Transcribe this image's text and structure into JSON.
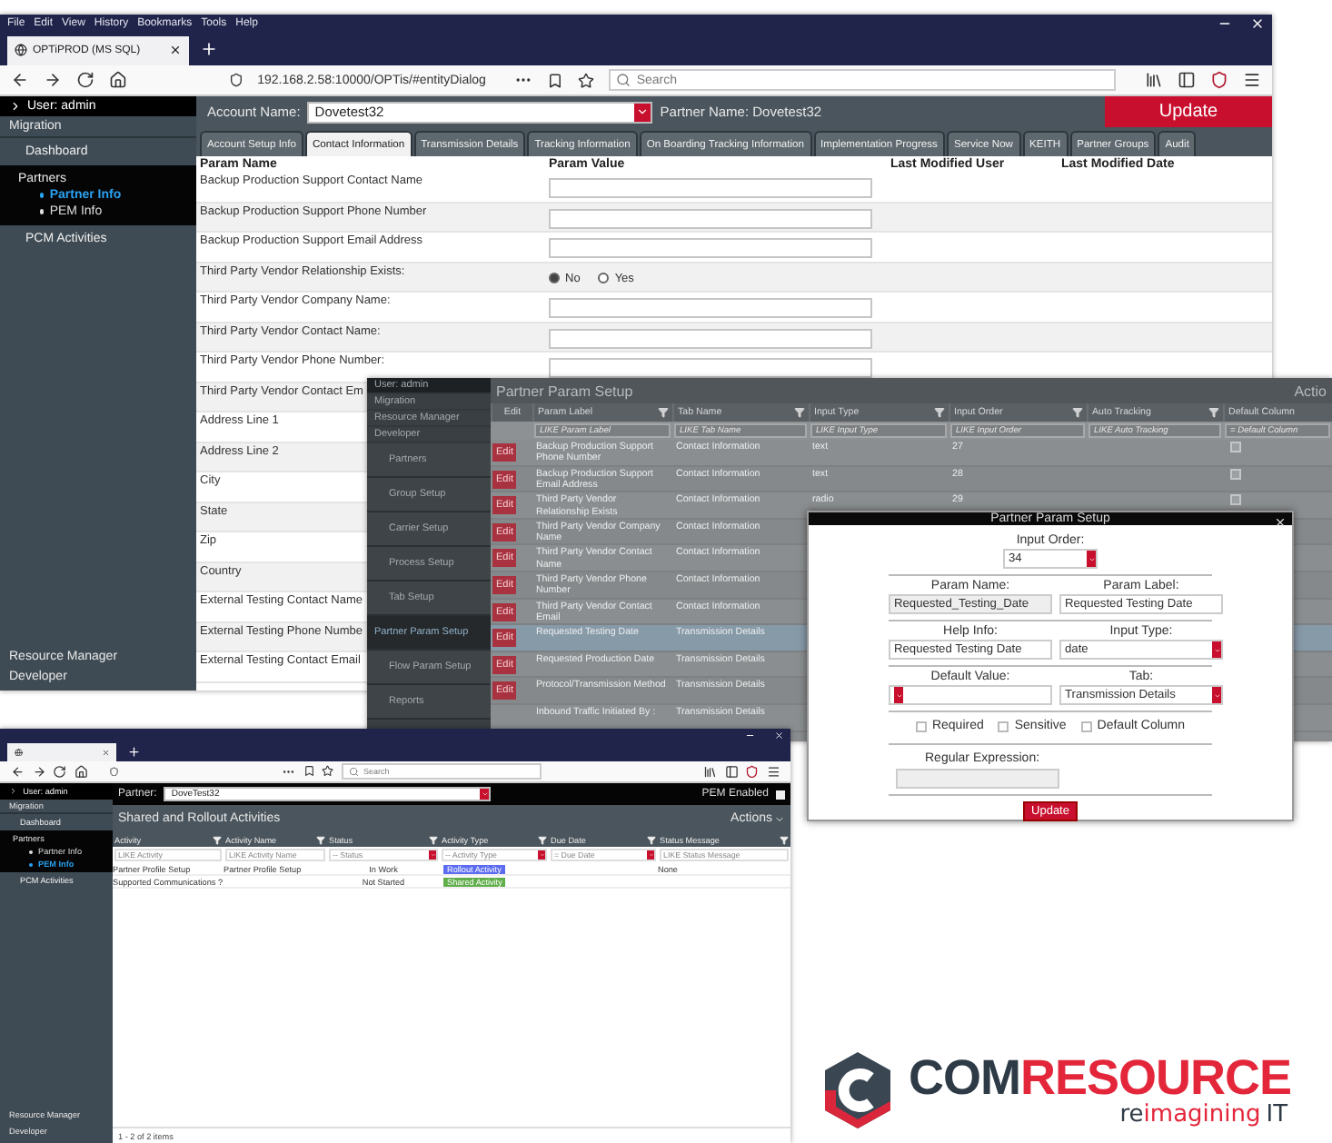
{
  "screenshot_a": {
    "browser": {
      "menu": [
        "File",
        "Edit",
        "View",
        "History",
        "Bookmarks",
        "Tools",
        "Help"
      ],
      "tab_title": "OPTiPROD (MS SQL)",
      "url": "192.168.2.58:10000/OPTis/#entityDialog",
      "search_placeholder": "Search"
    },
    "sidebar": {
      "user": "User: admin",
      "items": [
        {
          "label": "Migration",
          "kind": "header"
        },
        {
          "label": "Dashboard",
          "kind": "item"
        },
        {
          "label": "Partners",
          "kind": "group",
          "expanded": true,
          "children": [
            {
              "label": "Partner Info",
              "selected": true
            },
            {
              "label": "PEM Info",
              "selected": false
            }
          ]
        },
        {
          "label": "PCM Activities",
          "kind": "item"
        }
      ],
      "footer": [
        "Resource Manager",
        "Developer"
      ]
    },
    "account_label": "Account Name:",
    "account_value": "Dovetest32",
    "partner_name": "Partner Name: Dovetest32",
    "update_button": "Update",
    "tabs": [
      {
        "label": "Account Setup Info",
        "selected": false
      },
      {
        "label": "Contact Information",
        "selected": true
      },
      {
        "label": "Transmission Details",
        "selected": false
      },
      {
        "label": "Tracking Information",
        "selected": false
      },
      {
        "label": "On Boarding Tracking Information",
        "selected": false
      },
      {
        "label": "Implementation Progress",
        "selected": false
      },
      {
        "label": "Service Now",
        "selected": false
      },
      {
        "label": "KEITH",
        "selected": false
      },
      {
        "label": "Partner Groups",
        "selected": false
      },
      {
        "label": "Audit",
        "selected": false
      }
    ],
    "columns": [
      "Param Name",
      "Param Value",
      "Last Modified User",
      "Last Modified Date"
    ],
    "rows": [
      {
        "name": "Backup Production Support Contact Name",
        "kind": "text"
      },
      {
        "name": "Backup Production Support Phone Number",
        "kind": "text"
      },
      {
        "name": "Backup Production Support Email Address",
        "kind": "text"
      },
      {
        "name": "Third Party Vendor Relationship Exists:",
        "kind": "radio",
        "options": [
          {
            "label": "No",
            "selected": true
          },
          {
            "label": "Yes",
            "selected": false
          }
        ]
      },
      {
        "name": "Third Party Vendor Company Name:",
        "kind": "text"
      },
      {
        "name": "Third Party Vendor Contact Name:",
        "kind": "text"
      },
      {
        "name": "Third Party Vendor Phone Number:",
        "kind": "text"
      },
      {
        "name": "Third Party Vendor Contact Em",
        "kind": "label"
      },
      {
        "name": "Address Line 1",
        "kind": "label"
      },
      {
        "name": "Address Line 2",
        "kind": "label"
      },
      {
        "name": "City",
        "kind": "label"
      },
      {
        "name": "State",
        "kind": "label"
      },
      {
        "name": "Zip",
        "kind": "label"
      },
      {
        "name": "Country",
        "kind": "label"
      },
      {
        "name": "External Testing Contact Name",
        "kind": "label"
      },
      {
        "name": "External Testing Phone Numbe",
        "kind": "label"
      },
      {
        "name": "External Testing Contact Email",
        "kind": "label"
      }
    ]
  },
  "screenshot_b": {
    "sidebar": {
      "top": [
        "User: admin",
        "Migration",
        "Resource Manager",
        "Developer"
      ],
      "items": [
        {
          "label": "Partners",
          "selected": false
        },
        {
          "label": "Group Setup",
          "selected": false
        },
        {
          "label": "Carrier Setup",
          "selected": false
        },
        {
          "label": "Process Setup",
          "selected": false
        },
        {
          "label": "Tab Setup",
          "selected": false
        },
        {
          "label": "Partner Param Setup",
          "selected": true
        },
        {
          "label": "Flow Param Setup",
          "selected": false
        },
        {
          "label": "Reports",
          "selected": false
        }
      ]
    },
    "title": "Partner Param Setup",
    "actions": "Actio",
    "columns": [
      "Edit",
      "Param Label",
      "Tab Name",
      "Input Type",
      "Input Order",
      "Auto Tracking",
      "Default Column"
    ],
    "filters": [
      "LIKE Param Label",
      "LIKE Tab Name",
      "LIKE Input Type",
      "LIKE Input Order",
      "LIKE Auto Tracking",
      "= Default Column"
    ],
    "rows": [
      {
        "edit": "Edit",
        "label": "Backup Production Support Phone Number",
        "tab": "Contact Information",
        "input_type": "text",
        "input_order": "27",
        "default_column": false,
        "selected": false
      },
      {
        "edit": "Edit",
        "label": "Backup Production Support Email Address",
        "tab": "Contact Information",
        "input_type": "text",
        "input_order": "28",
        "default_column": false,
        "selected": false
      },
      {
        "edit": "Edit",
        "label": "Third Party Vendor Relationship Exists",
        "tab": "Contact Information",
        "input_type": "radio",
        "input_order": "29",
        "default_column": false,
        "selected": false
      },
      {
        "edit": "Edit",
        "label": "Third Party Vendor Company Name",
        "tab": "Contact Information",
        "selected": false
      },
      {
        "edit": "Edit",
        "label": "Third Party Vendor Contact Name",
        "tab": "Contact Information",
        "selected": false
      },
      {
        "edit": "Edit",
        "label": "Third Party Vendor Phone Number",
        "tab": "Contact Information",
        "selected": false
      },
      {
        "edit": "Edit",
        "label": "Third Party Vendor Contact Email",
        "tab": "Contact Information",
        "selected": false
      },
      {
        "edit": "Edit",
        "label": "Requested Testing Date",
        "tab": "Transmission Details",
        "selected": true
      },
      {
        "edit": "Edit",
        "label": "Requested Production Date",
        "tab": "Transmission Details",
        "selected": false
      },
      {
        "edit": "Edit",
        "label": "Protocol/Transmission Method",
        "tab": "Transmission Details",
        "selected": false
      },
      {
        "label": "Inbound Traffic Initiated By :",
        "tab": "Transmission Details",
        "selected": false
      }
    ]
  },
  "dialog": {
    "title": "Partner Param Setup",
    "rows": [
      [
        {
          "label": "Input Order:",
          "value": "34",
          "kind": "select"
        }
      ],
      [
        {
          "label": "Param Name:",
          "value": "Requested_Testing_Date",
          "kind": "readonly"
        },
        {
          "label": "Param Label:",
          "value": "Requested Testing Date",
          "kind": "text"
        }
      ],
      [
        {
          "label": "Help Info:",
          "value": "Requested Testing Date",
          "kind": "text"
        },
        {
          "label": "Input Type:",
          "value": "date",
          "kind": "select"
        }
      ],
      [
        {
          "label": "Default Value:",
          "kind": "select"
        },
        {
          "label": "Tab:",
          "value": "Transmission Details",
          "kind": "select"
        }
      ]
    ],
    "checkboxes": [
      {
        "label": "Required",
        "checked": false
      },
      {
        "label": "Sensitive",
        "checked": false
      },
      {
        "label": "Default Column",
        "checked": false
      }
    ],
    "regex_label": "Regular Expression:",
    "update_button": "Update"
  },
  "screenshot_c": {
    "browser": {
      "search_placeholder": "Search"
    },
    "sidebar": {
      "user": "User: admin",
      "items": [
        {
          "label": "Migration",
          "kind": "header"
        },
        {
          "label": "Dashboard",
          "kind": "item"
        },
        {
          "label": "Partners",
          "kind": "group",
          "expanded": true,
          "children": [
            {
              "label": "Partner Info",
              "selected": false
            },
            {
              "label": "PEM Info",
              "selected": true
            }
          ]
        },
        {
          "label": "PCM Activities",
          "kind": "item"
        }
      ],
      "footer": [
        "Resource Manager",
        "Developer"
      ]
    },
    "partner_label": "Partner:",
    "partner_value": "DoveTest32",
    "pem_label": "PEM Enabled",
    "pem_enabled": true,
    "title": "Shared and Rollout Activities",
    "actions": "Actions",
    "columns": [
      "Activity",
      "Activity Name",
      "Status",
      "Activity Type",
      "Due Date",
      "Status Message"
    ],
    "filters": [
      "LIKE Activity",
      "LIKE Activity Name",
      "-- Status",
      "-- Activity Type",
      "= Due Date",
      "LIKE Status Message"
    ],
    "rows": [
      {
        "activity": "Partner Profile Setup",
        "name": "Partner Profile Setup",
        "status": "In Work",
        "type": "Rollout Activity",
        "color": "#5b6cf0",
        "message": "None"
      },
      {
        "activity": "Supported Communications ?",
        "status": "Not Started",
        "type": "Shared Activity",
        "color": "#5fae4a"
      }
    ],
    "footer": "1 - 2 of 2 items"
  },
  "logo": {
    "wordmark": [
      {
        "text": "COM",
        "color": "#2e3a46"
      },
      {
        "text": "RESOURCE",
        "color": "#e3263a"
      }
    ],
    "tagline": [
      {
        "text": "re",
        "color": "#2e3a46"
      },
      {
        "text": "imagining",
        "color": "#e3263a"
      },
      {
        "text": "IT",
        "color": "#2e3a46"
      }
    ]
  }
}
